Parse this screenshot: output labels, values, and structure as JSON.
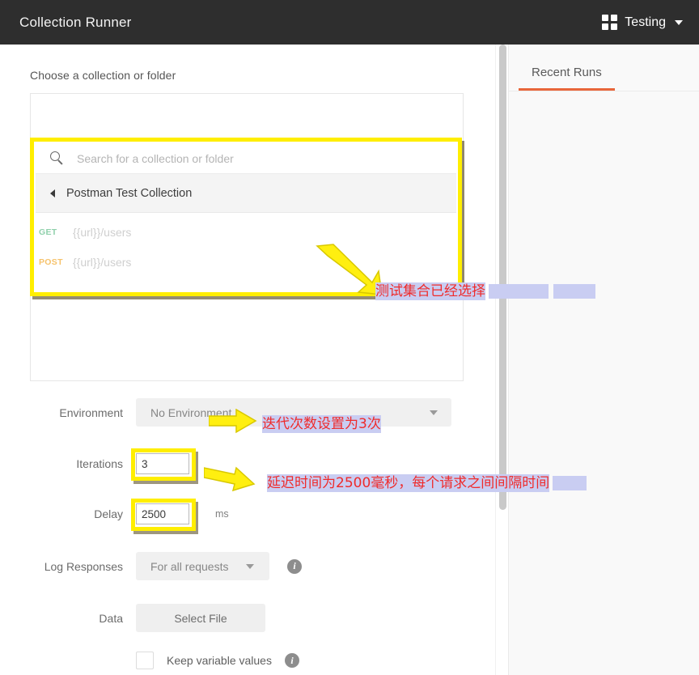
{
  "titlebar": {
    "title": "Collection Runner",
    "grid_icon": "grid-icon",
    "workspace": "Testing",
    "caret_icon": "chevron-down-icon"
  },
  "right_pane": {
    "tabs": [
      {
        "label": "Recent Runs",
        "active": true
      }
    ]
  },
  "left_pane": {
    "choose_label": "Choose a collection or folder",
    "search": {
      "placeholder": "Search for a collection or folder",
      "icon": "search-icon",
      "value": ""
    },
    "collection": {
      "name": "Postman Test Collection",
      "expander_icon": "triangle-left-icon"
    },
    "requests": [
      {
        "method": "GET",
        "url": "{{url}}/users"
      },
      {
        "method": "POST",
        "url": "{{url}}/users"
      }
    ],
    "form": {
      "environment": {
        "label": "Environment",
        "value": "No Environment",
        "caret_icon": "chevron-down-icon"
      },
      "iterations": {
        "label": "Iterations",
        "value": "3"
      },
      "delay": {
        "label": "Delay",
        "value": "2500",
        "unit": "ms"
      },
      "log_responses": {
        "label": "Log Responses",
        "value": "For all requests",
        "caret_icon": "chevron-down-icon",
        "info_icon": "info-icon"
      },
      "data": {
        "label": "Data",
        "button_label": "Select File"
      },
      "keep_variable_values": {
        "label": "Keep variable values",
        "checked": false,
        "info_icon": "info-icon"
      }
    }
  },
  "annotations": [
    {
      "id": "collection-selected",
      "text": "测试集合已经选择",
      "arrow": "arrow-diagonal-down-right"
    },
    {
      "id": "iterations-note",
      "text": "迭代次数设置为3次",
      "arrow": "arrow-right"
    },
    {
      "id": "delay-note",
      "text": "延迟时间为2500毫秒，每个请求之间间隔时间",
      "arrow": "arrow-right-tilted"
    }
  ],
  "colors": {
    "titlebar_bg": "#2e2e2e",
    "accent_tab": "#e8663a",
    "highlight_yellow": "#ffee00",
    "annotation_red": "#ef2b2b",
    "selection_blue": "#c9cdf2",
    "method_get": "#8fd0ab",
    "method_post": "#f6c26b"
  }
}
